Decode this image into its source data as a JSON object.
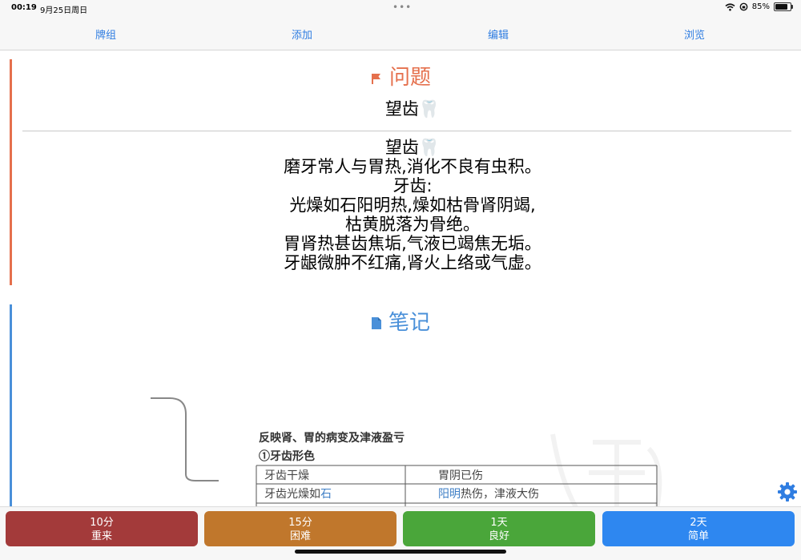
{
  "status_bar": {
    "time": "00:19",
    "date": "9月25日周日",
    "battery": "85%",
    "battery_level": 0.85
  },
  "nav": {
    "items": [
      "牌组",
      "添加",
      "编辑",
      "浏览"
    ]
  },
  "question": {
    "heading": "问题",
    "front": "望齿🦷",
    "back_lines": [
      "望齿🦷",
      "磨牙常人与胃热,消化不良有虫积。",
      "牙齿:",
      " 光燥如石阳明热,燥如枯骨肾阴竭,",
      "枯黄脱落为骨绝。",
      "胃肾热甚齿焦垢,气液已竭焦无垢。",
      "牙龈微肿不红痛,肾火上络或气虚。"
    ]
  },
  "note": {
    "heading": "笔记",
    "image": {
      "title": "反映肾、胃的病变及津液盈亏",
      "subtitle": "①牙齿形色",
      "rows": [
        {
          "left": "牙齿干燥",
          "right": "胃阴已伤"
        },
        {
          "left_prefix": "牙齿光燥如",
          "left_highlight": "石",
          "right_highlight": "阳明",
          "right_suffix": "热伤，津液大伤"
        }
      ]
    }
  },
  "answers": [
    {
      "time": "10分",
      "label": "重来",
      "color": "#a33a3a"
    },
    {
      "time": "15分",
      "label": "困难",
      "color": "#c0772c"
    },
    {
      "time": "1天",
      "label": "良好",
      "color": "#4aa63a"
    },
    {
      "time": "2天",
      "label": "简单",
      "color": "#2e87f0"
    }
  ],
  "colors": {
    "accent": "#2f7de1",
    "question": "#e5704d",
    "note": "#4a90d9"
  },
  "icons": [
    "wifi-icon",
    "lock-rotation-icon",
    "battery-icon",
    "flag-icon",
    "document-icon",
    "gear-icon"
  ]
}
